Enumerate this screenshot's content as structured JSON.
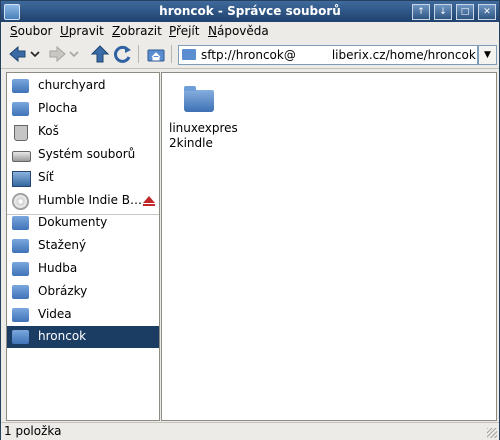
{
  "window": {
    "title": "hroncok - Správce souborů",
    "controls": [
      "↑",
      "↓",
      "□",
      "✕"
    ]
  },
  "menubar": {
    "items": [
      {
        "u": "S",
        "rest": "oubor"
      },
      {
        "u": "U",
        "rest": "pravit"
      },
      {
        "u": "Z",
        "rest": "obrazit"
      },
      {
        "u": "P",
        "rest": "řejít"
      },
      {
        "u": "N",
        "rest": "ápověda"
      }
    ]
  },
  "toolbar": {
    "back_icon": "arrow-left-icon",
    "forward_icon": "arrow-right-icon",
    "up_icon": "arrow-up-icon",
    "reload_icon": "reload-icon",
    "home_icon": "home-icon",
    "address_prefix": "sftp://hroncok@",
    "address_suffix": "liberix.cz/home/hroncok"
  },
  "sidebar": {
    "items": [
      {
        "label": "churchyard",
        "icon": "home-folder-icon",
        "selected": false
      },
      {
        "label": "Plocha",
        "icon": "desktop-folder-icon",
        "selected": false
      },
      {
        "label": "Koš",
        "icon": "trash-icon",
        "selected": false
      },
      {
        "label": "Systém souborů",
        "icon": "drive-icon",
        "selected": false
      },
      {
        "label": "Síť",
        "icon": "network-icon",
        "selected": false
      },
      {
        "label": "Humble Indie B…",
        "icon": "disc-icon",
        "selected": false,
        "eject": true
      },
      {
        "label": "Dokumenty",
        "icon": "documents-folder-icon",
        "selected": false
      },
      {
        "label": "Stažený",
        "icon": "downloads-folder-icon",
        "selected": false
      },
      {
        "label": "Hudba",
        "icon": "music-folder-icon",
        "selected": false
      },
      {
        "label": "Obrázky",
        "icon": "pictures-folder-icon",
        "selected": false
      },
      {
        "label": "Videa",
        "icon": "videos-folder-icon",
        "selected": false
      },
      {
        "label": "hroncok",
        "icon": "folder-icon",
        "selected": true
      }
    ]
  },
  "content": {
    "files": [
      {
        "name": "linuxexpres2kindle",
        "icon": "folder-icon"
      }
    ]
  },
  "statusbar": {
    "text": "1 položka"
  },
  "colors": {
    "titlebar": "#1f426e",
    "selection": "#1b3d64",
    "folder": "#3f73b8",
    "eject": "#c0282a"
  }
}
